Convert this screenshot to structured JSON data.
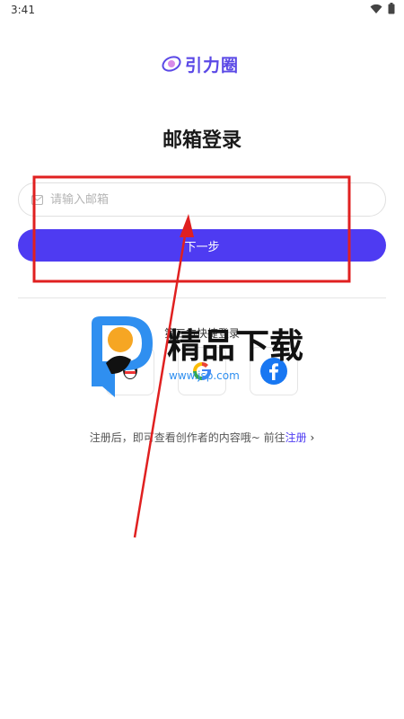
{
  "status_bar": {
    "time": "3:41"
  },
  "logo": {
    "text": "引力圈",
    "icon": "orbit-logo-icon"
  },
  "page": {
    "title": "邮箱登录"
  },
  "email": {
    "placeholder": "请输入邮箱",
    "value": "",
    "icon": "mail-icon"
  },
  "next_button": {
    "label": "下一步"
  },
  "third_party": {
    "title": "第三方快捷登录",
    "providers": [
      {
        "name": "qq",
        "icon": "qq-icon"
      },
      {
        "name": "google",
        "icon": "google-icon"
      },
      {
        "name": "facebook",
        "icon": "facebook-icon"
      }
    ]
  },
  "register": {
    "hint": "注册后，即可查看创作者的内容哦~ 前往",
    "link": "注册",
    "chevron": "›"
  },
  "watermark": {
    "text": "精品下载",
    "url": "www.jsp.com"
  },
  "colors": {
    "accent": "#4e3bf2",
    "annotation": "#e02020"
  }
}
